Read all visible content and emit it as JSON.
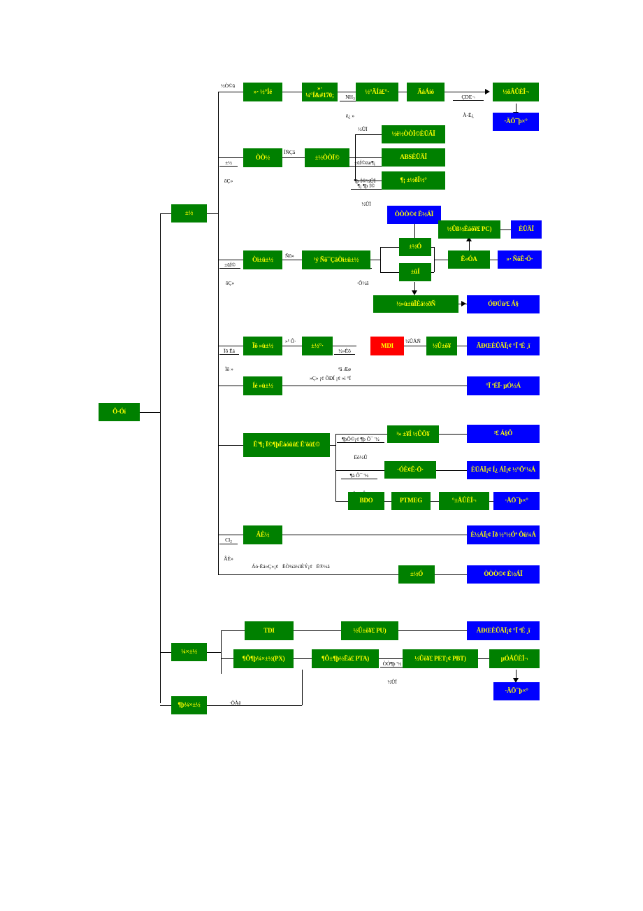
{
  "diagram": {
    "title": "Petrochemical downstream product tree (flowchart)",
    "colors": {
      "green_box": "#008000",
      "blue_box": "#0000ff",
      "red_box": "#ff0000",
      "box_text": "#ffff00",
      "line": "#000000",
      "background": "#ffffff"
    },
    "nodes": [
      {
        "id": "root",
        "label": "Ô-Óí",
        "color": "green"
      },
      {
        "id": "n_bing",
        "label": "±½",
        "color": "green"
      },
      {
        "id": "n_top1",
        "label": "»· ½°Íé",
        "color": "green"
      },
      {
        "id": "n_top2",
        "label": "»· ¼°Í&#170;",
        "color": "green"
      },
      {
        "id": "n_top3",
        "label": "½°ÄÍâ£°·",
        "color": "green"
      },
      {
        "id": "n_top4",
        "label": "ÄáÁíó",
        "color": "green"
      },
      {
        "id": "n_top5",
        "label": "½õÂÛÈÎ¬",
        "color": "green"
      },
      {
        "id": "n_top5b",
        "label": "·ÄÖ¯þ×°",
        "color": "blue"
      },
      {
        "id": "n_r2a",
        "label": "ÒÒ½",
        "color": "green"
      },
      {
        "id": "n_r2b",
        "label": "±½ÒÒÏ©",
        "color": "green"
      },
      {
        "id": "n_r2c1",
        "label": "½ê½ÒÒÏ©ÈÜÄÏ",
        "color": "green"
      },
      {
        "id": "n_r2c2",
        "label": "ABSÈÜÄÏ",
        "color": "green"
      },
      {
        "id": "n_r2c3",
        "label": "¶¡ ±½ðÏ½°",
        "color": "green"
      },
      {
        "id": "n_r3a",
        "label": "Òì±û±½",
        "color": "green"
      },
      {
        "id": "n_r3b",
        "label": "¹ý Ñõ¯ÇâÒì±û±½",
        "color": "green"
      },
      {
        "id": "n_r3c1",
        "label": "±½Ó",
        "color": "green"
      },
      {
        "id": "n_r3c2",
        "label": "±ûÍ",
        "color": "green"
      },
      {
        "id": "n_r3d1",
        "label": "ÒÒÒ©¢ È½ÁÏ",
        "color": "blue"
      },
      {
        "id": "n_r3d2",
        "label": "½Ûß½Èáõ¥£ PC)",
        "color": "green"
      },
      {
        "id": "n_r3d3",
        "label": "ÈÜÄÏ",
        "color": "blue"
      },
      {
        "id": "n_r3e1",
        "label": "Ê«ÓA",
        "color": "green"
      },
      {
        "id": "n_r3e2",
        "label": "»· ÑõÊ·Ö·",
        "color": "blue"
      },
      {
        "id": "n_r3f1",
        "label": "½»ù±ûÏÈá½ðÑ",
        "color": "green"
      },
      {
        "id": "n_r3f2",
        "label": "ÓÐÚù²£ Á§",
        "color": "blue"
      },
      {
        "id": "n_r4a",
        "label": "Ïõ »ù±½",
        "color": "green"
      },
      {
        "id": "n_r4b",
        "label": "±½°·",
        "color": "green"
      },
      {
        "id": "n_r4c",
        "label": "MDI",
        "color": "red"
      },
      {
        "id": "n_r4d",
        "label": "½Û±õ¥",
        "color": "green"
      },
      {
        "id": "n_r4e",
        "label": "ÄÐŒÈÛÄÏ¡¢ °Ï ªÉ ¸ï",
        "color": "blue"
      },
      {
        "id": "n_r5a",
        "label": "Íé »ù±½",
        "color": "green"
      },
      {
        "id": "n_r5b",
        "label": "°Ï ªÉÏ· µÓ½Á",
        "color": "blue"
      },
      {
        "id": "n_r6a",
        "label": "Ê'¶¡ Ï©¶þËáóûû£ Ê'ôû£©",
        "color": "green"
      },
      {
        "id": "n_r6b",
        "label": "²» ±¥Í ½ÛÖ¥",
        "color": "green"
      },
      {
        "id": "n_r6c",
        "label": "²£ Á§Ô",
        "color": "blue"
      },
      {
        "id": "n_r6d",
        "label": "·ÓÈ¢Ê·Ö·",
        "color": "green"
      },
      {
        "id": "n_r6e",
        "label": "ÈÜÄÏ¡¢ Í¿ ÁÏ¡¢ ½°Õ°¼Á",
        "color": "blue"
      },
      {
        "id": "n_r6f",
        "label": "BDO",
        "color": "green"
      },
      {
        "id": "n_r6g",
        "label": "PTMEG",
        "color": "green"
      },
      {
        "id": "n_r6h",
        "label": "°±ÂÛÈÎ¬",
        "color": "green"
      },
      {
        "id": "n_r6i",
        "label": "·ÄÖ¯þ×°",
        "color": "blue"
      },
      {
        "id": "n_r7a",
        "label": "ÂÈ½",
        "color": "green"
      },
      {
        "id": "n_r7b",
        "label": "È½ÁÏ¡¢ Ïð ½°½Óº Ôü¼Á",
        "color": "blue"
      },
      {
        "id": "n_r8a",
        "label": "±½Ó",
        "color": "green"
      },
      {
        "id": "n_r8b",
        "label": "ÒÒÒ©¢ È½ÁÏ",
        "color": "blue"
      },
      {
        "id": "n_b1",
        "label": "¼×±½",
        "color": "green"
      },
      {
        "id": "n_b2",
        "label": "¶þ¼×±½",
        "color": "green"
      },
      {
        "id": "n_b3",
        "label": "TDI",
        "color": "green"
      },
      {
        "id": "n_b4",
        "label": "½Û±õ¥£ PU)",
        "color": "green"
      },
      {
        "id": "n_b5",
        "label": "ÄÐŒÈÛÄÏ¡¢ °Ï ªÉ ¸ï",
        "color": "blue"
      },
      {
        "id": "n_b6",
        "label": "¶Ô¶þ¼×±½(PX)",
        "color": "green"
      },
      {
        "id": "n_b7",
        "label": "¶Ô±¶þ½Ëá£ PTA)",
        "color": "green"
      },
      {
        "id": "n_b8",
        "label": "½Ûõ¥£ PET¡¢ PBT)",
        "color": "green"
      },
      {
        "id": "n_b9",
        "label": "µÓÂÛÈÎ¬",
        "color": "green"
      },
      {
        "id": "n_b10",
        "label": "·ÄÖ¯þ×°",
        "color": "blue"
      }
    ],
    "edge_labels": [
      {
        "id": "e_top1",
        "text": "½Ò©â"
      },
      {
        "id": "e_top2",
        "top": "NH3",
        "bot": "ë¿ »"
      },
      {
        "id": "e_top3",
        "top": "ÇDE¬",
        "bot": "À-Ë¿"
      },
      {
        "id": "e_r2a",
        "top": "±½",
        "bot": "ôÇ»"
      },
      {
        "id": "e_r2b",
        "text": "ÍÑÇâ"
      },
      {
        "id": "e_r2c1",
        "text": "½ÛÏ"
      },
      {
        "id": "e_r2c2",
        "top": "±ûÍ©ëæ¶¡",
        "bot": "¶þ Í©½ÛÏ"
      },
      {
        "id": "e_r2c3",
        "top": "¶¡ ¶þ Í©",
        "bot": "½ÛÏ"
      },
      {
        "id": "e_r3a",
        "top": "±ûÍ©",
        "bot": "ôÇ»"
      },
      {
        "id": "e_r3b",
        "top": "Ñõ»",
        "bot": ""
      },
      {
        "id": "e_r3c",
        "top": "Ñõ»",
        "bot": "·Ô½â"
      },
      {
        "id": "e_r4a",
        "top": "Ïõ Ëá",
        "bot": "Ïõ »"
      },
      {
        "id": "e_r4b",
        "text": "»¹ Ô·"
      },
      {
        "id": "e_r4c",
        "top": "½»Èõ",
        "bot": "ªâ Æø"
      },
      {
        "id": "e_r4d",
        "text": "½ÛÃÑ"
      },
      {
        "id": "e_r5",
        "text": "»Ç» ¡¢ ÕÐÍ ¡¢ »ì °Ï"
      },
      {
        "id": "e_r6a",
        "top": "¶þÔ©¡¢ ¶þ Ô¯ '½",
        "bot": "Ëõ½Û"
      },
      {
        "id": "e_r6b",
        "top": "¶à Ô¯ '½",
        "bot": "Ëõ½Û"
      },
      {
        "id": "e_r7",
        "top": "Cl2",
        "bot": "ÂÈ»"
      },
      {
        "id": "e_r8",
        "text": "Áó·Ëá»Ç»¡¢   ËÒ¼ä¼îÈÝ¡¢   Ë®½â"
      },
      {
        "id": "e_b1",
        "text": "·ÖÀë"
      },
      {
        "id": "e_b2",
        "top": "ÒÒ¶þ '½",
        "bot": "½ÛÏ"
      }
    ]
  }
}
